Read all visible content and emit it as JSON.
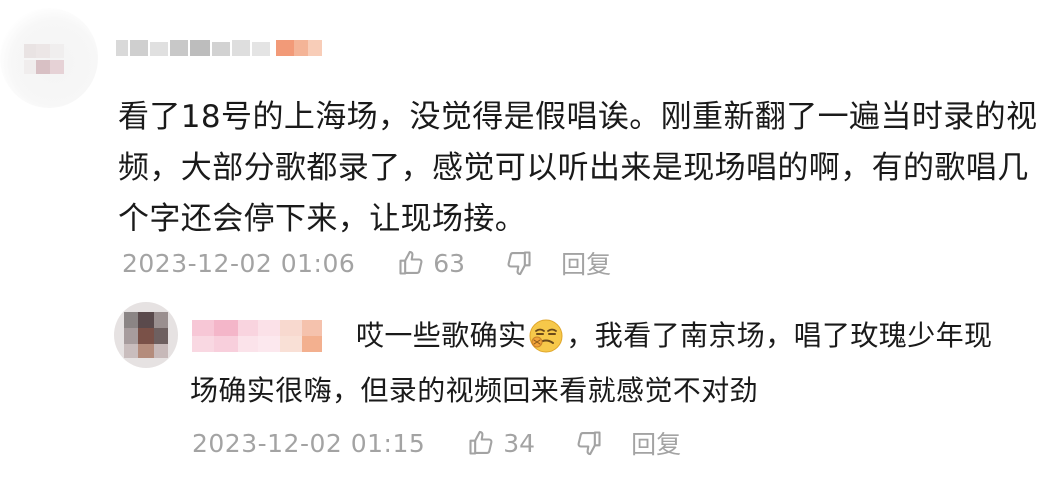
{
  "main_comment": {
    "text": "看了18号的上海场，没觉得是假唱诶。刚重新翻了一遍当时录的视频，大部分歌都录了，感觉可以听出来是现场唱的啊，有的歌唱几个字还会停下来，让现场接。",
    "timestamp": "2023-12-02 01:06",
    "like_count": "63",
    "reply_label": "回复"
  },
  "reply_comment": {
    "text_before_emoji": "哎一些歌确实",
    "emoji": "smirk-emoji",
    "text_after_emoji": "，我看了南京场，唱了玫瑰少年现",
    "text_line2": "场确实很嗨，但录的视频回来看就感觉不对劲",
    "timestamp": "2023-12-02 01:15",
    "like_count": "34",
    "reply_label": "回复"
  },
  "colors": {
    "text": "#1a1a1a",
    "meta": "#a3a3a3",
    "blurred_orange": "#f29a78",
    "blurred_pink": "#f6c4d2"
  }
}
